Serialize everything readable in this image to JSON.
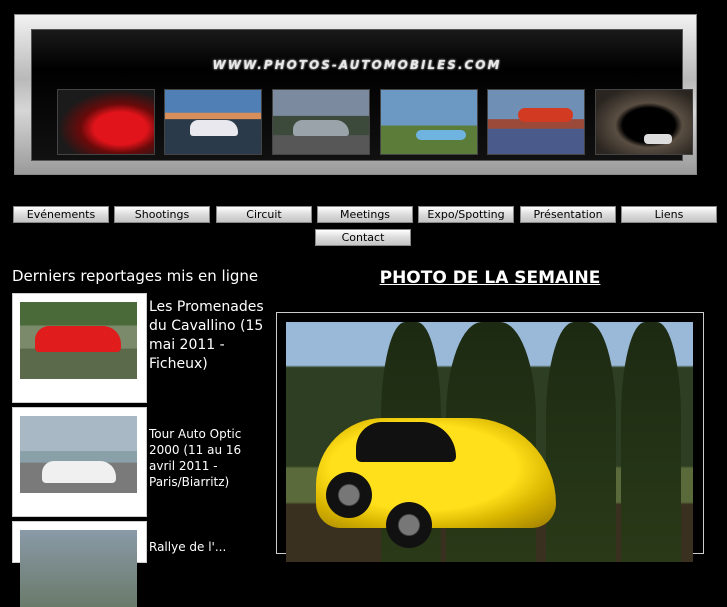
{
  "site": {
    "logo_text": "WWW.PHOTOS-AUTOMOBILES.COM"
  },
  "banner": {
    "thumbnails": [
      "red-sports-car-thumbnail",
      "silver-grand-tourer-thumbnail",
      "grey-sedan-thumbnail",
      "jet-and-race-car-thumbnail",
      "race-cars-on-track-thumbnail",
      "car-in-tunnel-thumbnail"
    ]
  },
  "nav": {
    "items": [
      {
        "label": "Evénements"
      },
      {
        "label": "Shootings"
      },
      {
        "label": "Circuit"
      },
      {
        "label": "Meetings"
      },
      {
        "label": "Expo/Spotting"
      },
      {
        "label": "Présentation"
      },
      {
        "label": "Liens"
      },
      {
        "label": "Contact"
      }
    ]
  },
  "latest": {
    "title": "Derniers reportages mis en ligne",
    "items": [
      {
        "text": "Les Promenades du Cavallino (15 mai 2011 - Ficheux)"
      },
      {
        "text": "Tour Auto Optic 2000 (11 au 16 avril 2011 - Paris/Biarritz)"
      },
      {
        "text": "Rallye de l'..."
      }
    ]
  },
  "photo_of_week": {
    "title": "PHOTO DE LA SEMAINE"
  },
  "colors": {
    "background": "#000000",
    "text": "#ffffff",
    "button_face": "#dcdcdc"
  }
}
